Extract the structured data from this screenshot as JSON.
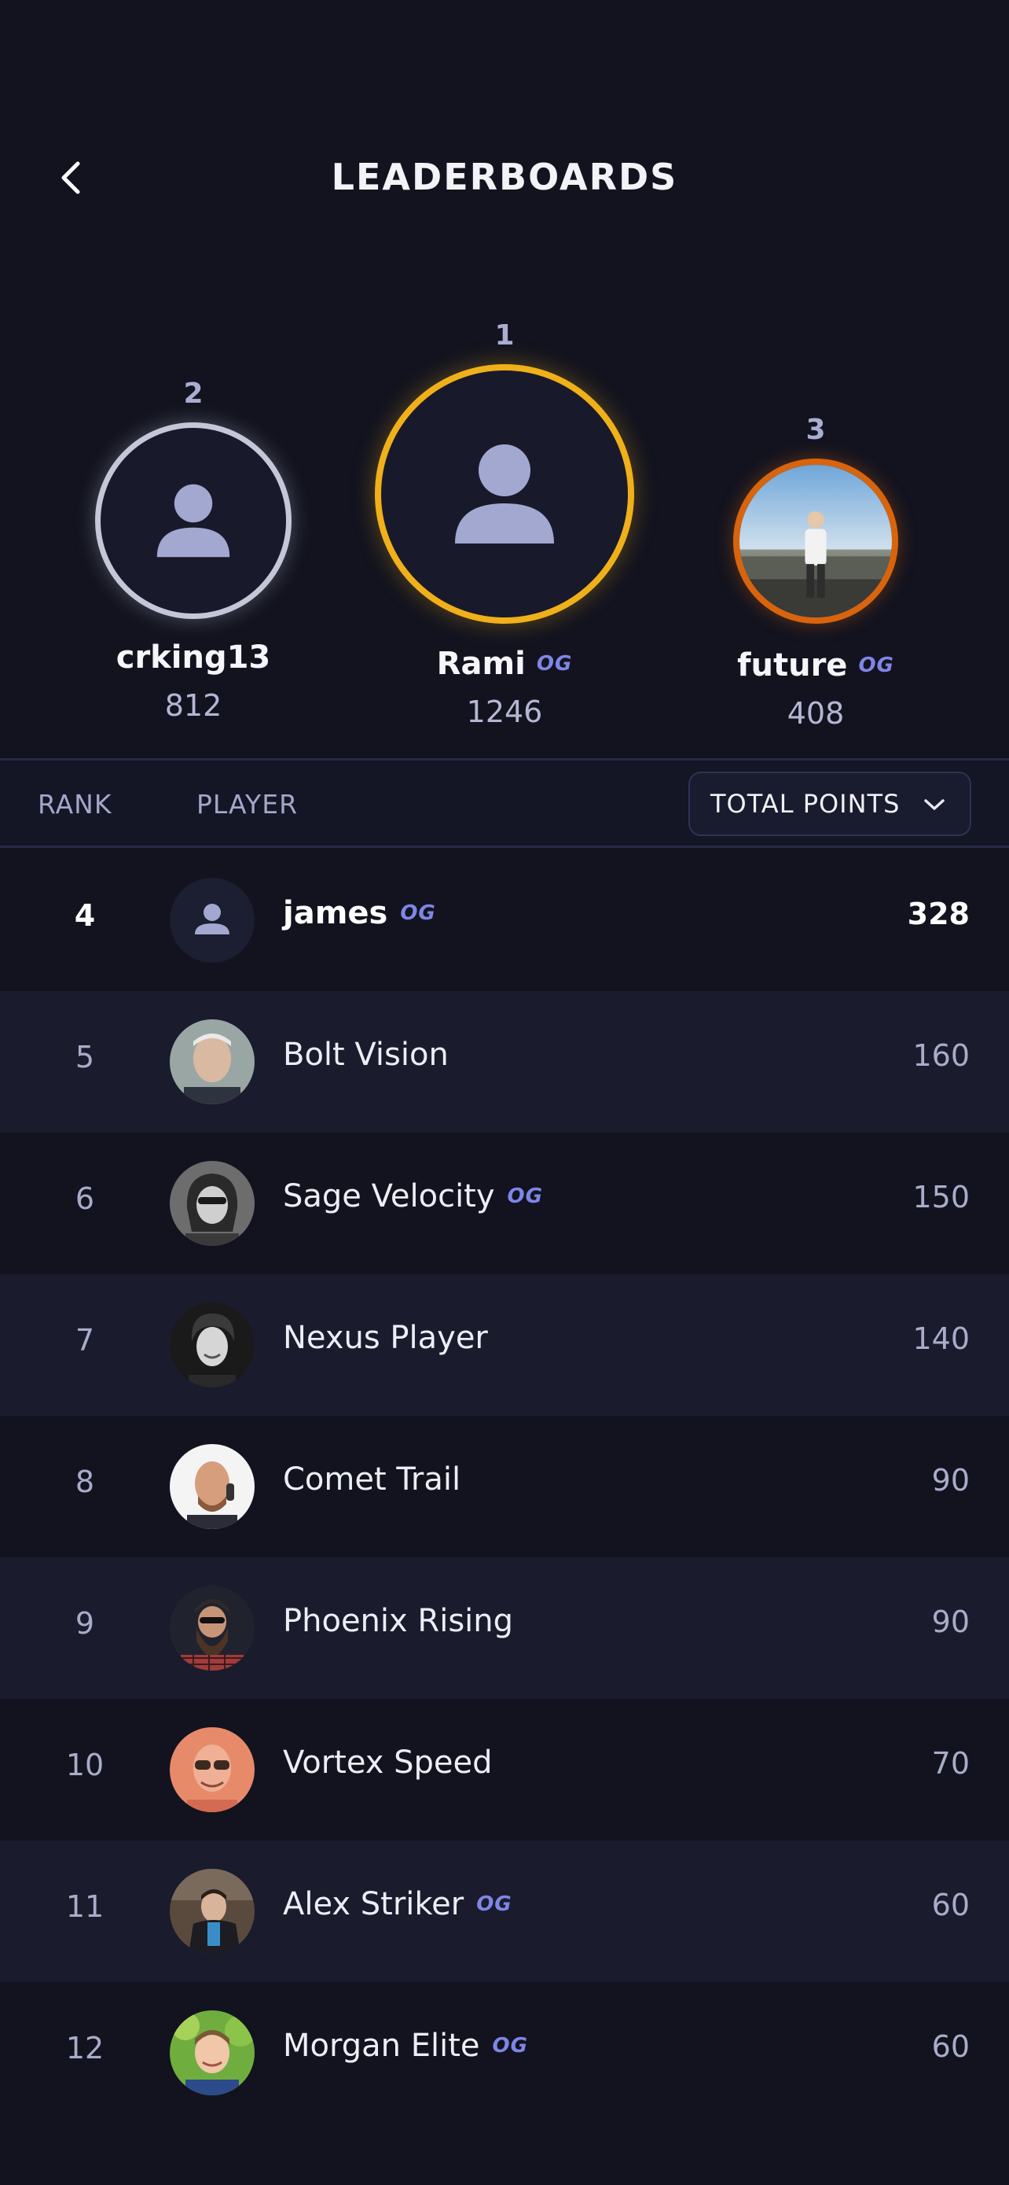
{
  "header": {
    "title": "LEADERBOARDS"
  },
  "podium": [
    {
      "rank": "2",
      "name": "crking13",
      "score": "812",
      "og": "",
      "ring_color": "#c4c7d8",
      "avatar": "person-placeholder-icon"
    },
    {
      "rank": "1",
      "name": "Rami",
      "score": "1246",
      "og": "OG",
      "ring_color": "#f0b01a",
      "avatar": "person-placeholder-icon"
    },
    {
      "rank": "3",
      "name": "future",
      "score": "408",
      "og": "OG",
      "ring_color": "#d8640d",
      "avatar": "photo"
    }
  ],
  "columns": {
    "rank": "RANK",
    "player": "PLAYER",
    "sort": "TOTAL POINTS"
  },
  "rows": [
    {
      "rank": "4",
      "name": "james",
      "og": "OG",
      "score": "328",
      "avatar": "person-placeholder-icon"
    },
    {
      "rank": "5",
      "name": "Bolt Vision",
      "og": "",
      "score": "160",
      "avatar": "photo"
    },
    {
      "rank": "6",
      "name": "Sage Velocity",
      "og": "OG",
      "score": "150",
      "avatar": "photo"
    },
    {
      "rank": "7",
      "name": "Nexus Player",
      "og": "",
      "score": "140",
      "avatar": "photo"
    },
    {
      "rank": "8",
      "name": "Comet Trail",
      "og": "",
      "score": "90",
      "avatar": "photo"
    },
    {
      "rank": "9",
      "name": "Phoenix Rising",
      "og": "",
      "score": "90",
      "avatar": "photo"
    },
    {
      "rank": "10",
      "name": "Vortex Speed",
      "og": "",
      "score": "70",
      "avatar": "photo"
    },
    {
      "rank": "11",
      "name": "Alex Striker",
      "og": "OG",
      "score": "60",
      "avatar": "photo"
    },
    {
      "rank": "12",
      "name": "Morgan Elite",
      "og": "OG",
      "score": "60",
      "avatar": "photo"
    }
  ],
  "colors": {
    "background": "#12131f",
    "og_badge": "#7f86e6",
    "gold": "#f0b01a",
    "silver": "#c4c7d8",
    "bronze": "#d8640d"
  }
}
